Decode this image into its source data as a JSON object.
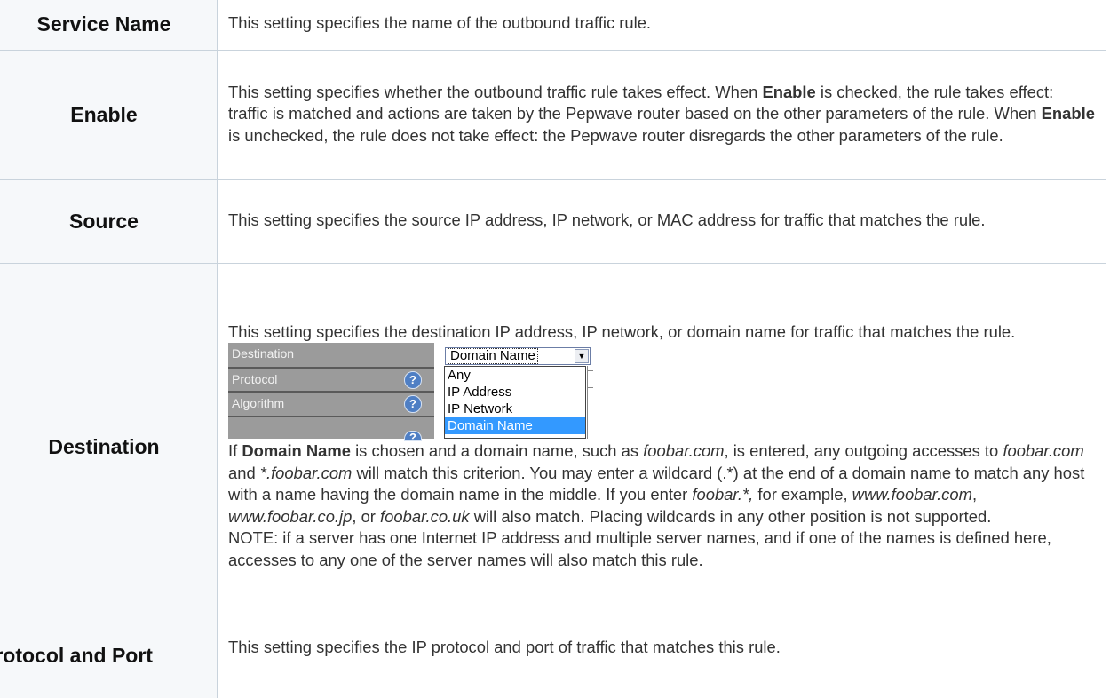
{
  "rows": [
    {
      "term": "Service Name",
      "text": "This setting specifies the name of the outbound traffic rule."
    },
    {
      "term": "Enable",
      "p1": "This setting specifies whether the outbound traffic rule takes effect. When ",
      "b1": "Enable",
      "p2": " is checked, the rule takes effect: traffic is matched and actions are taken by the Pepwave router based on the other parameters of the rule. When ",
      "b2": "Enable",
      "p3": " is unchecked, the rule does not take effect: the Pepwave router disregards the other parameters of the rule."
    },
    {
      "term": "Source",
      "text": "This setting specifies the source IP address, IP network, or MAC address for traffic that matches the rule."
    },
    {
      "term": "Destination",
      "intro": "This setting specifies the destination IP address, IP network, or domain name for traffic that matches the rule.",
      "screenshot": {
        "labels": [
          "Destination",
          "Protocol",
          "Algorithm"
        ],
        "selected": "Domain Name",
        "options": [
          "Any",
          "IP Address",
          "IP Network",
          "Domain Name"
        ],
        "help_icon": "question-circle-icon",
        "help_glyph": "?",
        "arrow_glyph": "▼",
        "help_color": "#4f7fc4",
        "highlight_color": "#3399ff"
      },
      "d1": "If ",
      "d_bold": "Domain Name",
      "d2": " is chosen and a domain name, such as ",
      "d_i1": "foobar.com",
      "d3": ", is entered, any outgoing accesses to ",
      "d_i2": "foobar.com",
      "d4": " and ",
      "d_i3": "*.foobar.com",
      "d5": " will match this criterion. You may enter a wildcard (.*) at the end of a domain name to match any host with a name having the domain name in the middle. If you enter ",
      "d_i4": "foobar.*,",
      "d6": " for example, ",
      "d_i5": "www.foobar.com",
      "d7": ", ",
      "d_i6": "www.foobar.co.jp",
      "d8": ", or ",
      "d_i7": "foobar.co.uk",
      "d9": " will also match. Placing wildcards in any other position is not supported.",
      "note": "NOTE: if a server has one Internet IP address and multiple server names, and if one of the names is defined here, accesses to any one of the server names will also match this rule."
    },
    {
      "term": "Protocol and Port",
      "text": "This setting specifies the IP protocol and port of traffic that matches this rule."
    }
  ]
}
